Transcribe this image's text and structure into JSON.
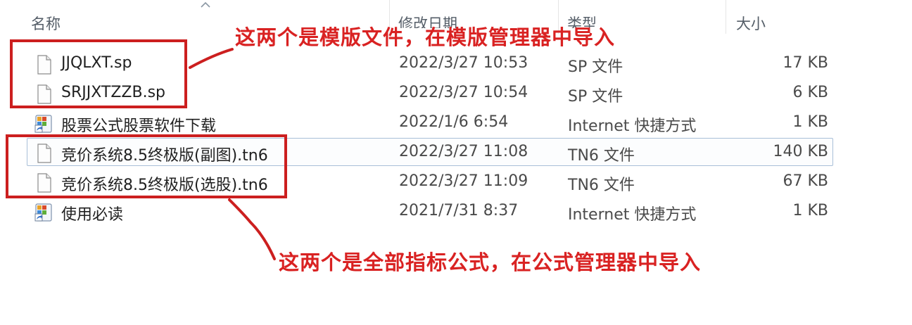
{
  "columns": {
    "name": "名称",
    "modified": "修改日期",
    "type": "类型",
    "size": "大小"
  },
  "files": [
    {
      "name": "JJQLXT.sp",
      "modified": "2022/3/27 10:53",
      "type": "SP 文件",
      "size": "17 KB",
      "icon": "blank-file-icon"
    },
    {
      "name": "SRJJXTZZB.sp",
      "modified": "2022/3/27 10:54",
      "type": "SP 文件",
      "size": "6 KB",
      "icon": "blank-file-icon"
    },
    {
      "name": "股票公式股票软件下载",
      "modified": "2022/1/6 6:54",
      "type": "Internet 快捷方式",
      "size": "1 KB",
      "icon": "internet-shortcut-icon"
    },
    {
      "name": "竞价系统8.5终极版(副图).tn6",
      "modified": "2022/3/27 11:08",
      "type": "TN6 文件",
      "size": "140 KB",
      "icon": "blank-file-icon"
    },
    {
      "name": "竞价系统8.5终极版(选股).tn6",
      "modified": "2022/3/27 11:09",
      "type": "TN6 文件",
      "size": "67 KB",
      "icon": "blank-file-icon"
    },
    {
      "name": "使用必读",
      "modified": "2021/7/31 8:37",
      "type": "Internet 快捷方式",
      "size": "1 KB",
      "icon": "internet-shortcut-icon"
    }
  ],
  "selected_row": 3,
  "annotations": {
    "top_note": "这两个是模版文件，在模版管理器中导入",
    "bottom_note": "这两个是全部指标公式，在公式管理器中导入",
    "color": "#d92222"
  }
}
